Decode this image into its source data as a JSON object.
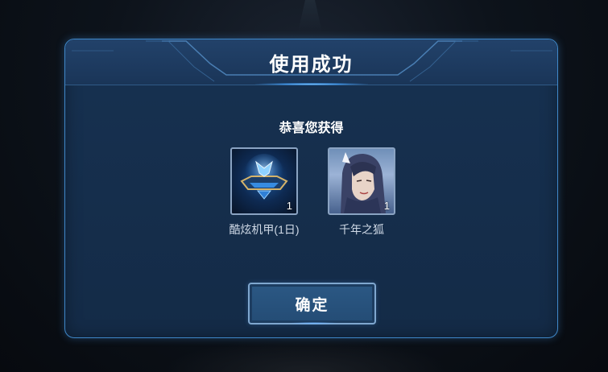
{
  "dialog": {
    "title": "使用成功",
    "subtitle": "恭喜您获得",
    "confirm_label": "确定"
  },
  "rewards": [
    {
      "name": "酷炫机甲(1日)",
      "quantity": "1",
      "icon": "mecha-frame-icon"
    },
    {
      "name": "千年之狐",
      "quantity": "1",
      "icon": "fox-hero-skin-portrait"
    }
  ],
  "colors": {
    "frame_border": "#3f87c8",
    "panel_bg": "#16304f",
    "button_bg": "#2b5884",
    "text_primary": "#ffffff",
    "text_secondary": "#cfd9e6"
  }
}
